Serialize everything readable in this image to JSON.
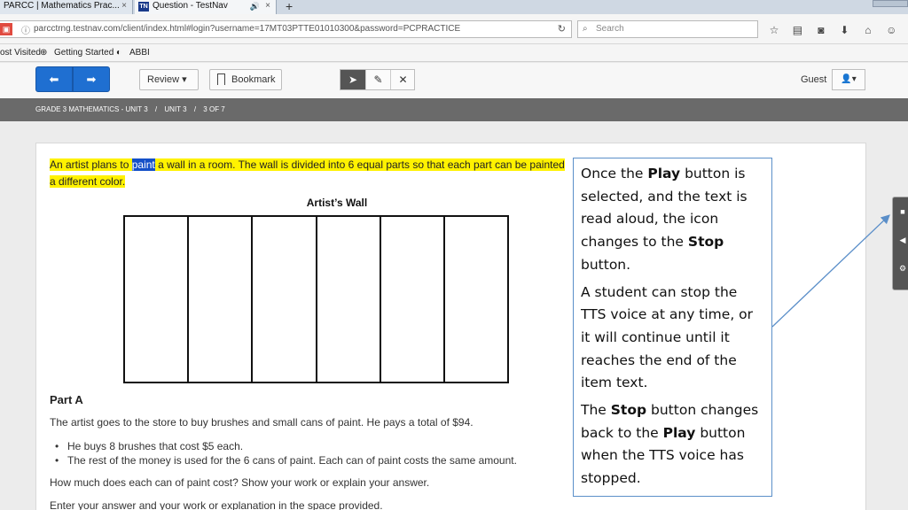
{
  "browser": {
    "tabs": [
      {
        "label": "PARCC | Mathematics Prac...",
        "close": "×"
      },
      {
        "label": "Question - TestNav",
        "badge": "TN",
        "close": "×"
      }
    ],
    "new_tab": "+",
    "url": "parcctrng.testnav.com/client/index.html#login?username=17MT03PTTE01010300&password=PCPRACTICE",
    "search_placeholder": "Search",
    "bookmarks": [
      "ost Visited",
      "Getting Started",
      "ABBI"
    ]
  },
  "toolbar": {
    "review_label": "Review ▾",
    "bookmark_label": "Bookmark",
    "guest_label": "Guest",
    "user_menu": "▾"
  },
  "breadcrumb": [
    "GRADE 3 MATHEMATICS - UNIT 3",
    "/",
    "UNIT 3",
    "/",
    "3 OF 7"
  ],
  "item": {
    "intro_before": "An artist plans to ",
    "intro_selected": "paint",
    "intro_after": " a wall in a room. The wall is divided into 6 equal parts so that each part can be painted a different color.",
    "figure_title": "Artist’s Wall",
    "wall_parts": 6,
    "part_heading": "Part A",
    "question_text": "The artist goes to the store to buy brushes and small cans of paint. He pays a total of $94.",
    "bullets": [
      "He buys 8 brushes that cost $5 each.",
      "The rest of the money is used for the 6 cans of paint. Each can of paint costs the same amount."
    ],
    "prompt": "How much does each can of paint cost? Show your work or explain your answer.",
    "instruction": "Enter your answer and your work or explanation in the space provided."
  },
  "callout": {
    "p1_a": "Once the ",
    "p1_b": "Play",
    "p1_c": " button is selected, and the text is read aloud, the icon changes to the ",
    "p1_d": "Stop",
    "p1_e": " button.",
    "p2": "A student can stop the TTS voice at any time, or it will continue until it reaches the end of the item text.",
    "p3_a": "The ",
    "p3_b": "Stop",
    "p3_c": " button changes back to the ",
    "p3_d": "Play",
    "p3_e": " button when the TTS voice has stopped."
  },
  "colors": {
    "nav_blue": "#1f6fd1",
    "highlight": "#fff200",
    "selection": "#1450c8",
    "breadcrumb_bg": "#6a6a6a",
    "callout_border": "#5b8fc9"
  }
}
